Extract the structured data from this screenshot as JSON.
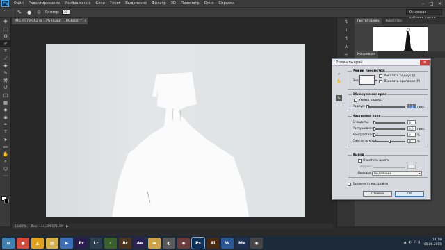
{
  "app": {
    "logo": "Ps",
    "menu": [
      "Файл",
      "Редактирование",
      "Изображение",
      "Слои",
      "Текст",
      "Выделение",
      "Фильтр",
      "3D",
      "Просмотр",
      "Окно",
      "Справка"
    ],
    "window_controls": [
      "–",
      "□",
      "✕"
    ]
  },
  "options_bar": {
    "size_label": "Размер:",
    "size_value": "30",
    "workspace": "Основная рабочая среда"
  },
  "document": {
    "tab_title": "IMG_9579.CR2 @ 17% (Слой 1, RGB/16) *",
    "tab_close": "×",
    "zoom": "16,67%",
    "doc_info": "Док: 114,2M/171,3M"
  },
  "panels": {
    "tabs": [
      "Гистограмма",
      "Навигатор"
    ],
    "corrections_tab": "Коррекция"
  },
  "dialog": {
    "title": "Уточнить край",
    "close": "✕",
    "view_mode": {
      "group_title": "Режим просмотра",
      "view_label": "Вид:",
      "show_radius": "Показать радиус (J)",
      "show_original": "Показать оригинал (P)"
    },
    "edge_detection": {
      "group_title": "Обнаружение края",
      "smart_radius": "Умный радиус",
      "radius_label": "Радиус:",
      "radius_value": "2,2",
      "radius_unit": "пикс."
    },
    "adjust_edge": {
      "group_title": "Настройка края",
      "rows": [
        {
          "label": "Сгладить:",
          "value": "0",
          "unit": ""
        },
        {
          "label": "Растушевка:",
          "value": "0,0",
          "unit": "пикс."
        },
        {
          "label": "Контрастность:",
          "value": "0",
          "unit": "%"
        },
        {
          "label": "Сместить край:",
          "value": "0",
          "unit": "%"
        }
      ]
    },
    "output": {
      "group_title": "Вывод",
      "decontaminate": "Очистить цвета",
      "amount_label": "Эффект:",
      "output_to_label": "Вывод в:",
      "output_to_value": "Выделение"
    },
    "remember": "Запомнить настройки",
    "cancel": "Отмена",
    "ok": "ОК"
  },
  "taskbar": {
    "apps": [
      {
        "name": "start",
        "glyph": "⊞",
        "color": "#3c7fb1"
      },
      {
        "name": "chrome",
        "glyph": "●",
        "color": "#d44a3a"
      },
      {
        "name": "browser-arrow",
        "glyph": "◭",
        "color": "#e0a21b"
      },
      {
        "name": "explorer",
        "glyph": "▤",
        "color": "#d8b04a"
      },
      {
        "name": "media-player",
        "glyph": "▶",
        "color": "#3b6fb5"
      },
      {
        "name": "premiere",
        "glyph": "Pr",
        "color": "#2b1e4e"
      },
      {
        "name": "lightroom",
        "glyph": "Lr",
        "color": "#2c3d4e"
      },
      {
        "name": "winamp",
        "glyph": "⚡",
        "color": "#3a5f2a"
      },
      {
        "name": "bridge",
        "glyph": "Br",
        "color": "#4a3420"
      },
      {
        "name": "after-effects",
        "glyph": "Ae",
        "color": "#2a2250"
      },
      {
        "name": "folder",
        "glyph": "▬",
        "color": "#c9a24a"
      },
      {
        "name": "media-app",
        "glyph": "◐",
        "color": "#5a5a5a"
      },
      {
        "name": "tool-app",
        "glyph": "◆",
        "color": "#6b3a3a"
      },
      {
        "name": "photoshop",
        "glyph": "Ps",
        "color": "#0f3157"
      },
      {
        "name": "illustrator",
        "glyph": "Ai",
        "color": "#4a2a10"
      },
      {
        "name": "word",
        "glyph": "W",
        "color": "#2b5796"
      },
      {
        "name": "media-encoder",
        "glyph": "Me",
        "color": "#1f2f50"
      },
      {
        "name": "camera-app",
        "glyph": "◉",
        "color": "#454545"
      }
    ],
    "tray_glyphs": [
      "▲",
      "◐",
      "♪",
      "▮"
    ],
    "clock_time": "11:18",
    "clock_date": "05.06.2015"
  }
}
